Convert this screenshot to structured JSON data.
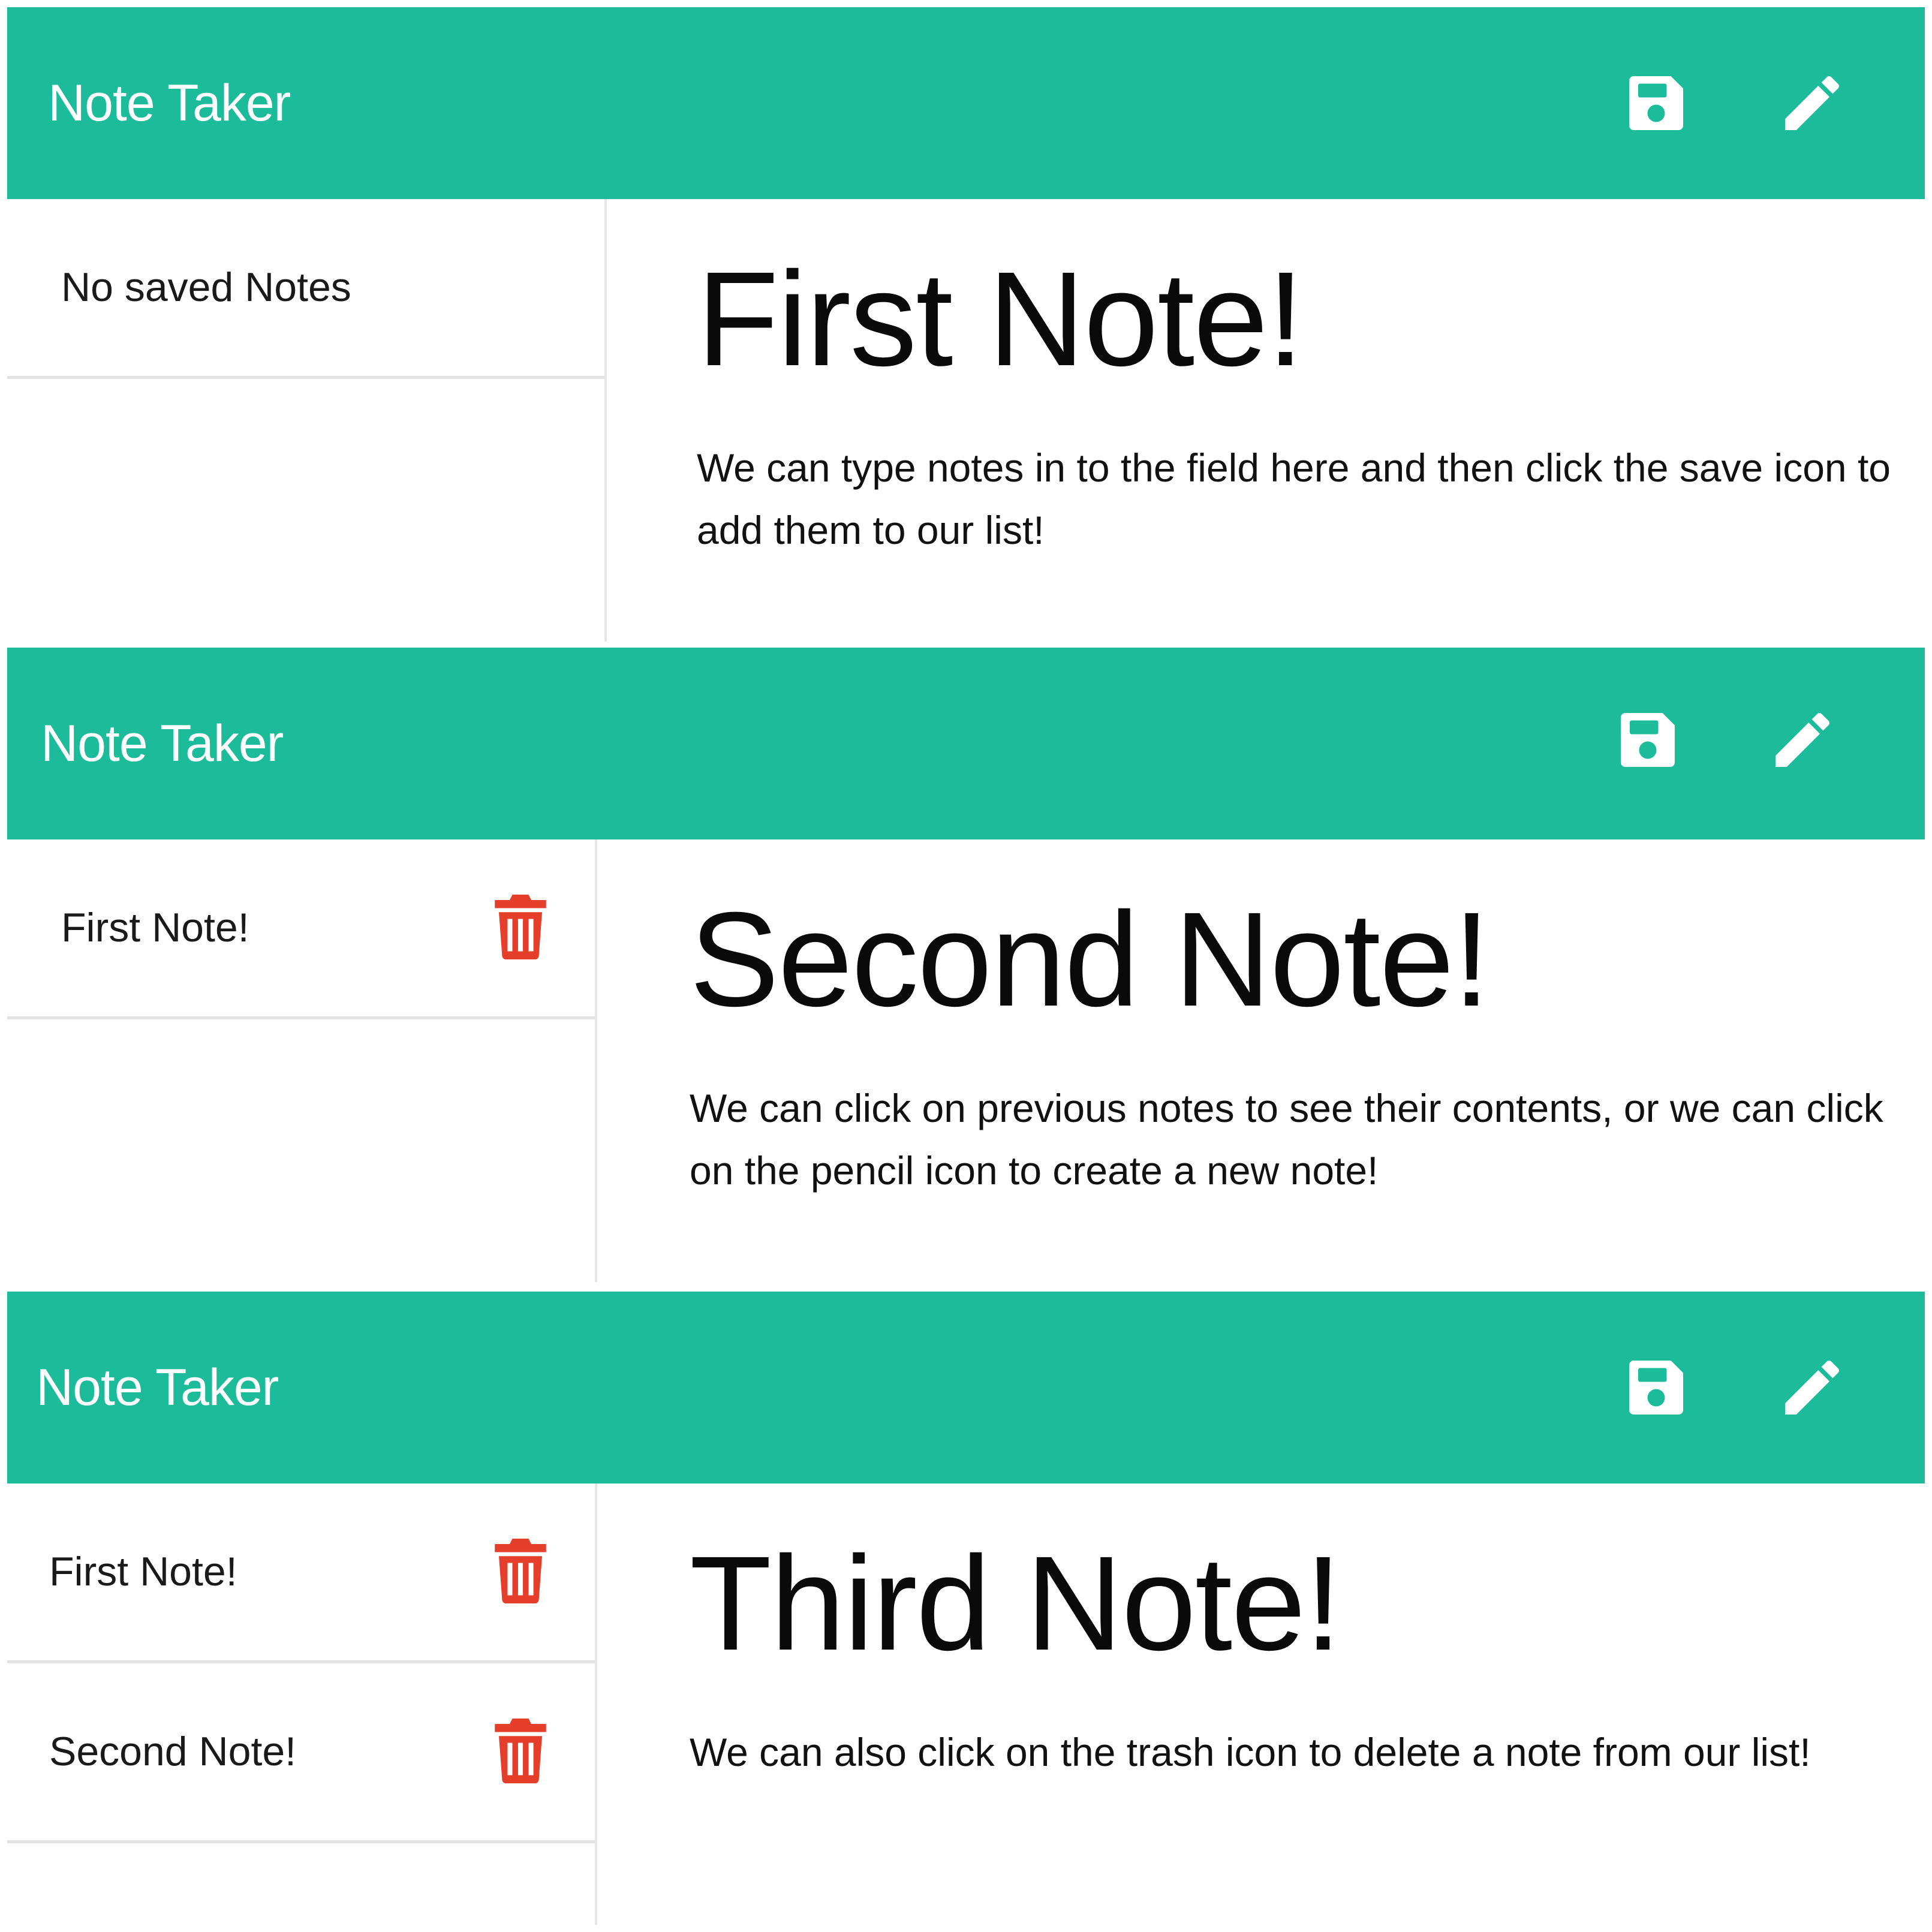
{
  "colors": {
    "navbar_bg": "#1cbc9b",
    "nav_icon": "#ffffff",
    "trash_icon": "#e53e2a"
  },
  "icons": {
    "save": "floppy-disk",
    "new": "pencil",
    "delete": "trash-can"
  },
  "panels": [
    {
      "app_title": "Note Taker",
      "notes_list": {
        "empty_message": "No saved Notes",
        "items": []
      },
      "editor": {
        "title": "First Note!",
        "text": "We can type notes in to the field here and then click the save icon to add them to our list!"
      }
    },
    {
      "app_title": "Note Taker",
      "notes_list": {
        "items": [
          {
            "title": "First Note!"
          }
        ]
      },
      "editor": {
        "title": "Second Note!",
        "text": "We can click on previous notes to see their contents, or we can click on the pencil icon to create a new note!"
      }
    },
    {
      "app_title": "Note Taker",
      "notes_list": {
        "items": [
          {
            "title": "First Note!"
          },
          {
            "title": "Second Note!"
          }
        ]
      },
      "editor": {
        "title": "Third Note!",
        "text": "We can also click on the trash icon to delete a note from our list!"
      }
    }
  ]
}
